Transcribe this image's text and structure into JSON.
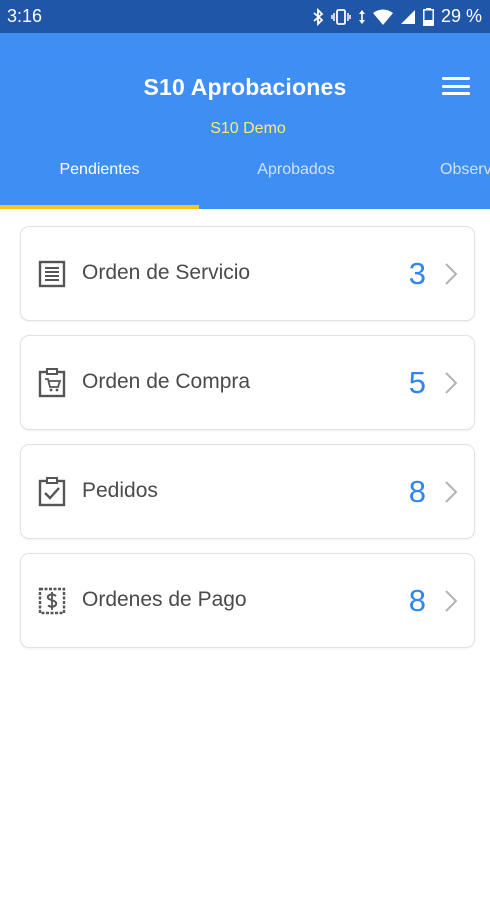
{
  "status_bar": {
    "time": "3:16",
    "battery": "29 %",
    "icons": [
      "bluetooth-icon",
      "vibrate-icon",
      "wifi-icon",
      "signal-icon",
      "battery-icon"
    ]
  },
  "header": {
    "title": "S10 Aprobaciones",
    "subtitle": "S10 Demo",
    "menu_icon": "hamburger-menu-icon"
  },
  "tabs": [
    {
      "label": "Pendientes",
      "active": true
    },
    {
      "label": "Aprobados",
      "active": false
    },
    {
      "label": "Observados",
      "active": false
    }
  ],
  "items": [
    {
      "label": "Orden de Servicio",
      "count": "3",
      "icon": "document-list-icon"
    },
    {
      "label": "Orden de Compra",
      "count": "5",
      "icon": "shopping-cart-clipboard-icon"
    },
    {
      "label": "Pedidos",
      "count": "8",
      "icon": "clipboard-check-icon"
    },
    {
      "label": "Ordenes de Pago",
      "count": "8",
      "icon": "dollar-receipt-icon"
    }
  ],
  "colors": {
    "status_bar": "#1f56a8",
    "app_bar": "#3f8ef3",
    "subtitle": "#f6ef74",
    "tab_indicator": "#f7c61d",
    "count": "#2d86ee"
  }
}
